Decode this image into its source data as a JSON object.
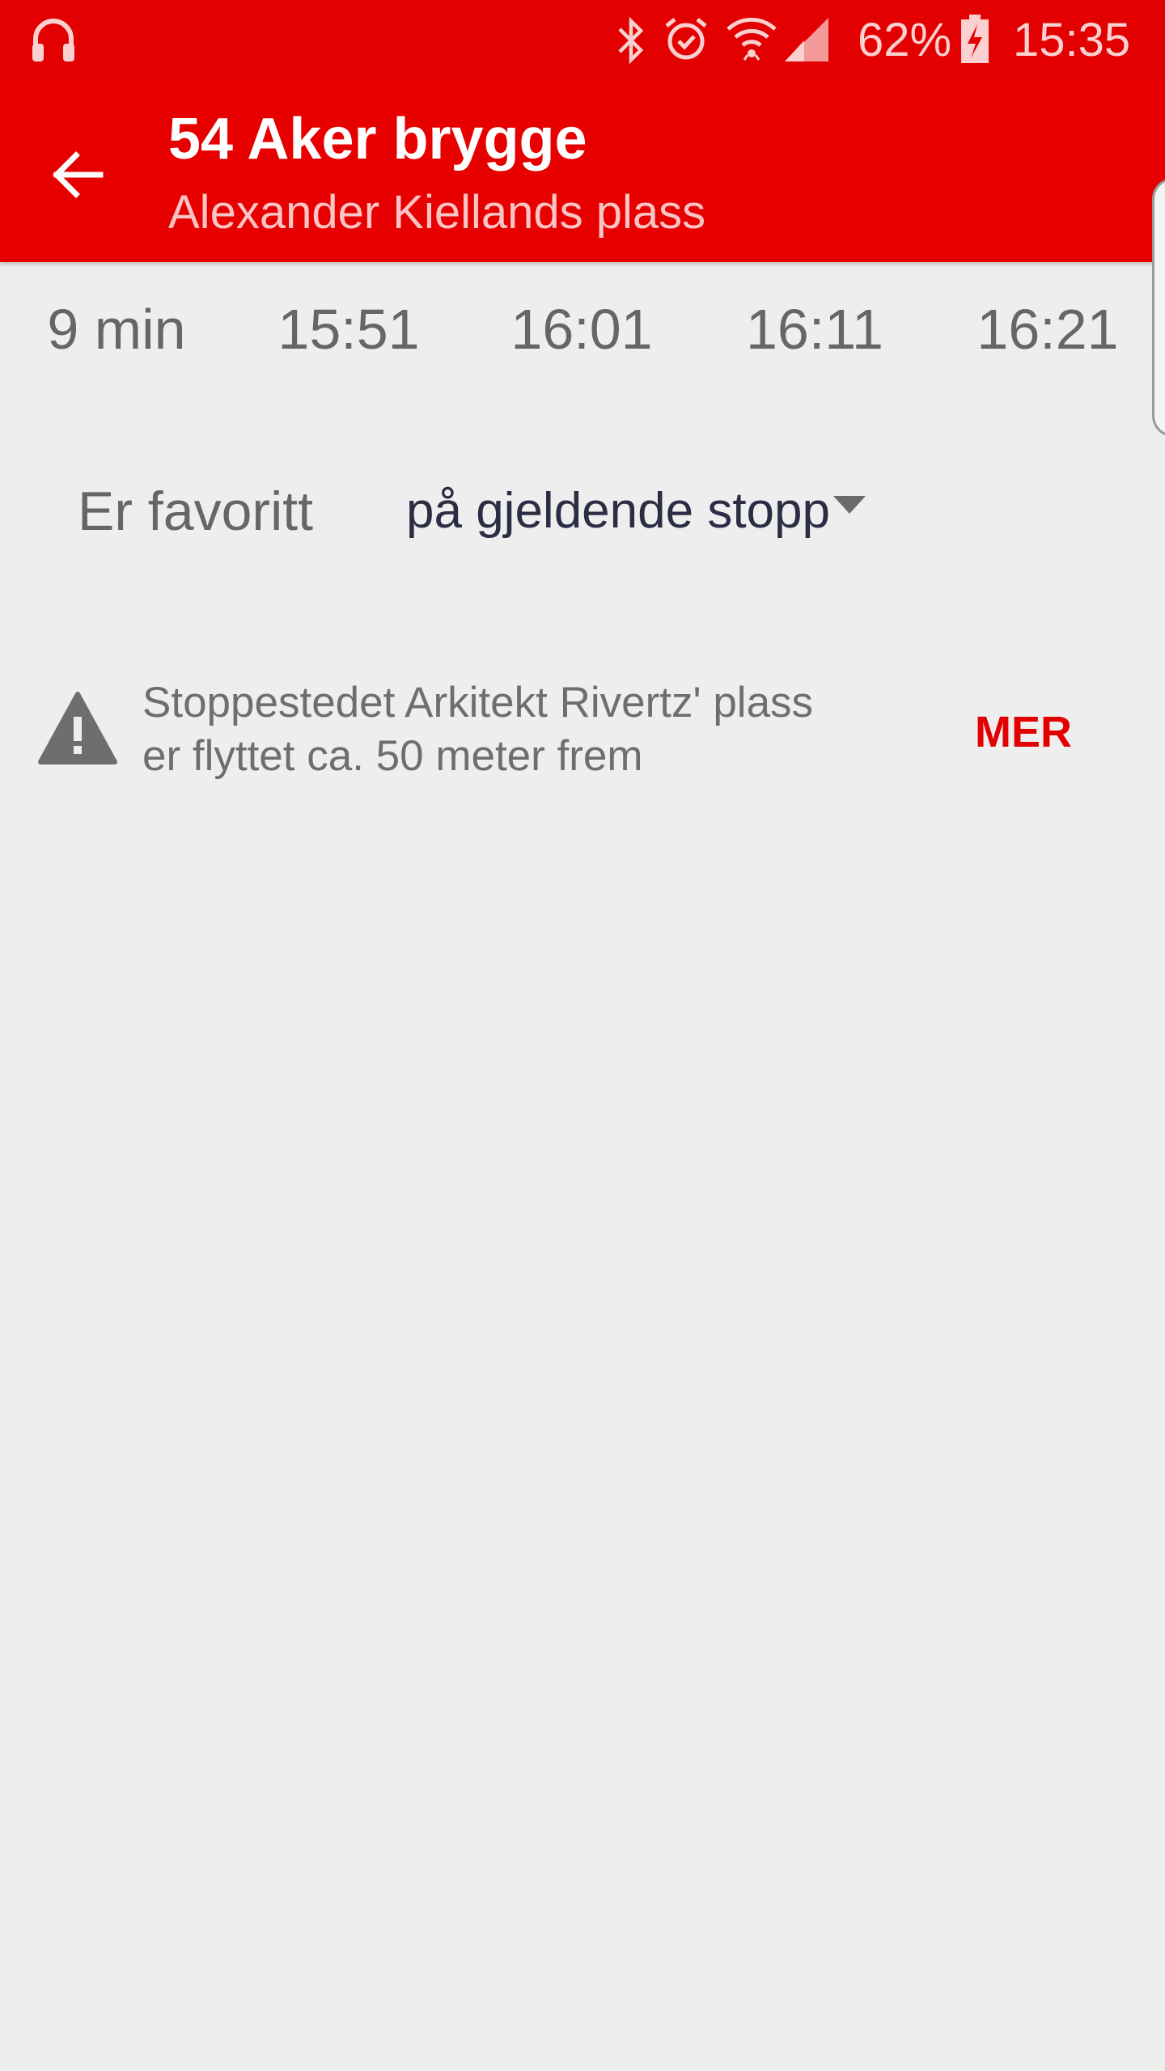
{
  "status_bar": {
    "battery_percent": "62%",
    "time": "15:35",
    "icons": [
      "headphones-icon",
      "bluetooth-icon",
      "alarm-icon",
      "wifi-icon",
      "cell-signal-icon",
      "battery-charging-icon"
    ]
  },
  "app_bar": {
    "title": "54 Aker brygge",
    "subtitle": "Alexander Kiellands plass",
    "back_icon": "arrow-back-icon"
  },
  "departures": [
    "9 min",
    "15:51",
    "16:01",
    "16:11",
    "16:21"
  ],
  "favorite": {
    "label": "Er favoritt",
    "selected_option": "på gjeldende stopp"
  },
  "notice": {
    "icon": "warning-icon",
    "line1": "Stoppestedet Arkitekt Rivertz' plass",
    "line2": "er flyttet ca. 50 meter frem",
    "action_label": "MER"
  },
  "colors": {
    "accent_red": "#e60000",
    "background": "#eeeeee",
    "muted_text": "#666666",
    "dark_text": "#2b2d44"
  }
}
